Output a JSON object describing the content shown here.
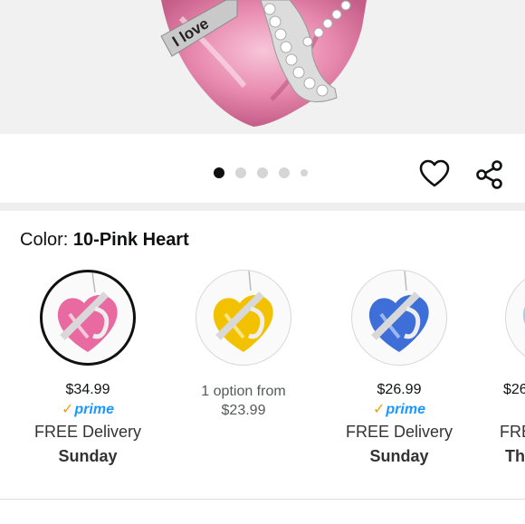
{
  "hero": {
    "engraving": "I love"
  },
  "gallery": {
    "image_count": 5,
    "active_index": 0
  },
  "actions": {
    "wishlist_icon": "heart-outline-icon",
    "share_icon": "share-icon"
  },
  "variation": {
    "label": "Color:",
    "selected_value": "10-Pink Heart",
    "options": [
      {
        "color": "#e86aa0",
        "price": "$34.99",
        "prime": "prime",
        "delivery": "FREE Delivery",
        "day": "Sunday",
        "selected": true
      },
      {
        "color": "#f2c200",
        "option_text_1": "1 option from",
        "option_text_2": "$23.99",
        "selected": false
      },
      {
        "color": "#3e6fd8",
        "price": "$26.99",
        "prime": "prime",
        "delivery": "FREE Delivery",
        "day": "Sunday",
        "selected": false
      },
      {
        "color": "#9fd3f2",
        "price": "$26",
        "delivery": "FRE",
        "day": "Th",
        "selected": false
      }
    ]
  },
  "colors": {
    "prime_blue": "#1a98ff",
    "prime_check": "#ff9900",
    "text_primary": "#0f1111",
    "text_secondary": "#565959"
  }
}
